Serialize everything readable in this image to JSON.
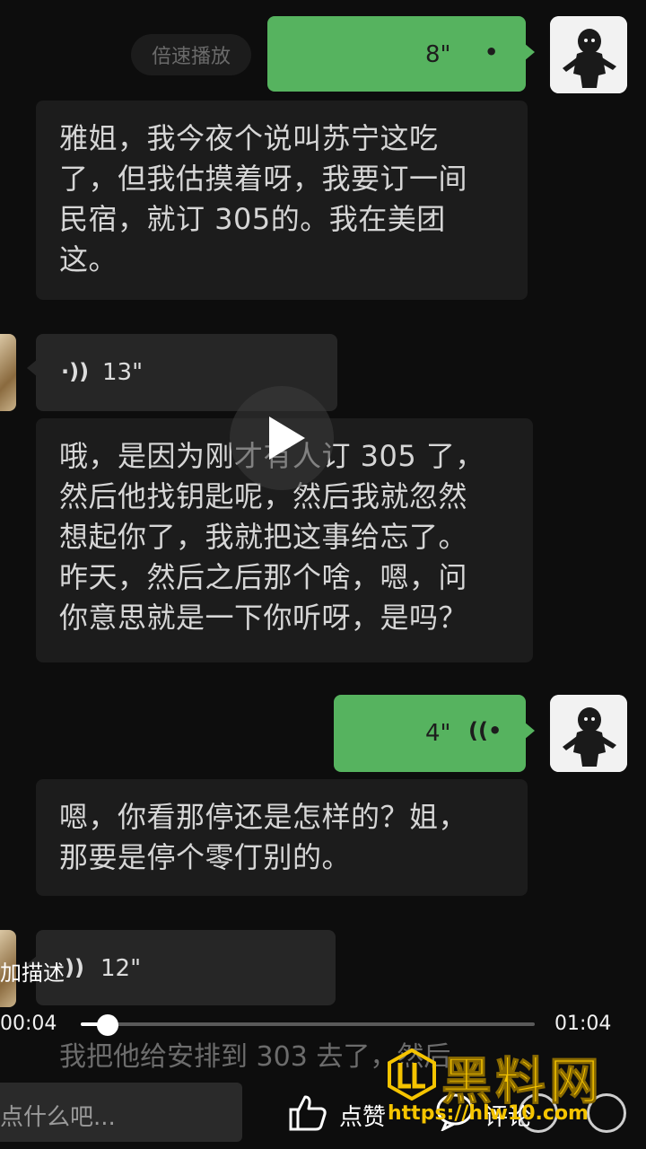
{
  "speed_button": "倍速播放",
  "messages": [
    {
      "side": "right",
      "duration": "8\""
    },
    {
      "text": "雅姐，我今夜个说叫苏宁这吃\n了，但我估摸着呀，我要订一间\n民宿，就订 305的。我在美团\n这。"
    },
    {
      "side": "left",
      "duration": "13\""
    },
    {
      "text": "哦，是因为刚才有人订 305 了，\n然后他找钥匙呢，然后我就忽然\n想起你了，我就把这事给忘了。\n昨天，然后之后那个啥，嗯，问\n你意思就是一下你听呀，是吗？"
    },
    {
      "side": "right",
      "duration": "4\""
    },
    {
      "text": "嗯，你看那停还是怎样的？姐，\n那要是停个零仃别的。"
    },
    {
      "side": "left",
      "duration": "12\""
    },
    {
      "text": "我把他给安排到 303 去了，然后"
    }
  ],
  "description_label": "加描述",
  "player": {
    "current_time": "00:04",
    "total_time": "01:04",
    "progress": 0.06
  },
  "comment_placeholder": "点什么吧...",
  "like_label": "点赞",
  "comment_label": "评论",
  "watermark": {
    "title": "黑料网",
    "url": "https://hlw10.com"
  },
  "colors": {
    "sent_bubble": "#56b35f",
    "received_bubble": "#262626",
    "background": "#0d0d0d",
    "watermark": "#f5c400"
  },
  "icons": [
    "play-icon",
    "voice-wave-icon",
    "thumbs-up-icon",
    "comment-icon",
    "share-icon",
    "more-icon"
  ]
}
